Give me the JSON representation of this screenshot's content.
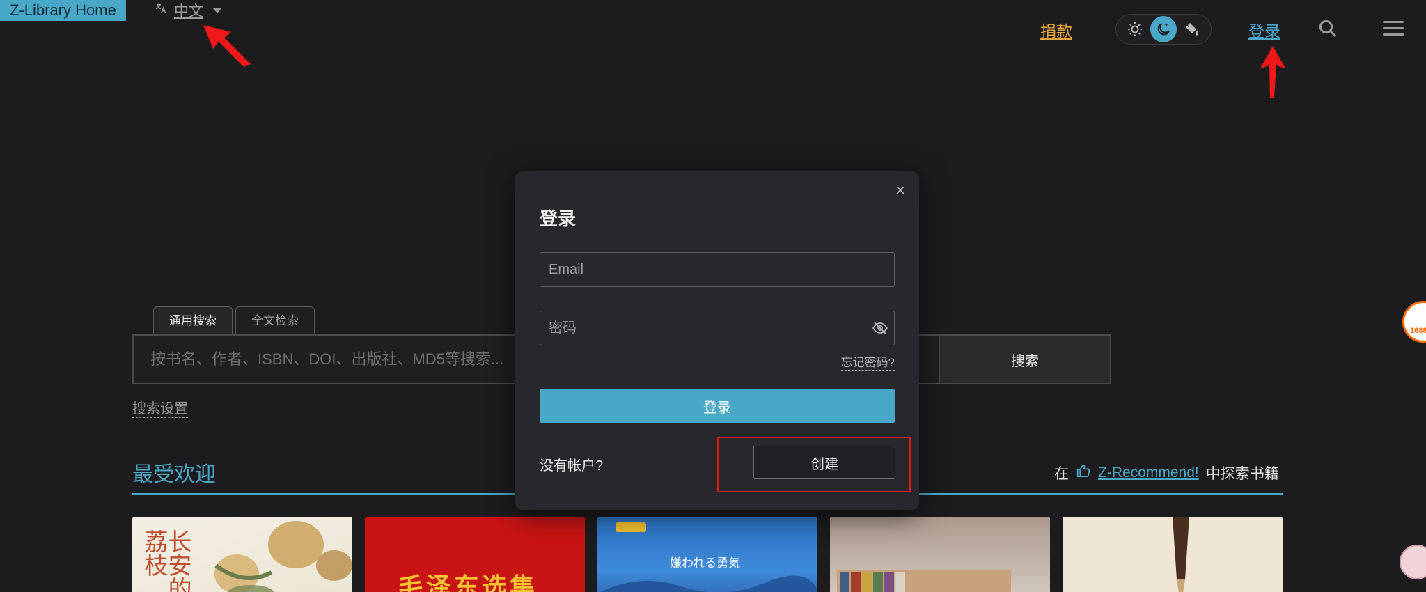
{
  "header": {
    "home": "Z-Library Home",
    "language": "中文",
    "donate": "捐款",
    "login": "登录"
  },
  "search": {
    "tabs": [
      "通用搜索",
      "全文检索"
    ],
    "placeholder": "按书名、作者、ISBN、DOI、出版社、MD5等搜索...",
    "button": "搜索",
    "settings": "搜索设置"
  },
  "popular": {
    "title": "最受欢迎",
    "recommend_prefix": "在",
    "recommend_link": "Z-Recommend!",
    "recommend_suffix": "中探索书籍",
    "books": [
      {
        "title": "长安的荔枝"
      },
      {
        "title": "毛泽东选集"
      },
      {
        "title": "嫌われる勇気"
      },
      {
        "title": ""
      },
      {
        "title": ""
      }
    ]
  },
  "modal": {
    "title": "登录",
    "close": "×",
    "email_placeholder": "Email",
    "password_placeholder": "密码",
    "forgot": "忘记密码?",
    "submit": "登录",
    "no_account": "没有帐户?",
    "create": "创建"
  },
  "colors": {
    "accent": "#49a8c8",
    "donate": "#e7a33c",
    "highlight": "#e0191b",
    "background": "#1c1c1e"
  },
  "theme": {
    "options": [
      "sun-icon",
      "moon-icon",
      "paint-bucket-icon"
    ],
    "active": "moon-icon"
  }
}
